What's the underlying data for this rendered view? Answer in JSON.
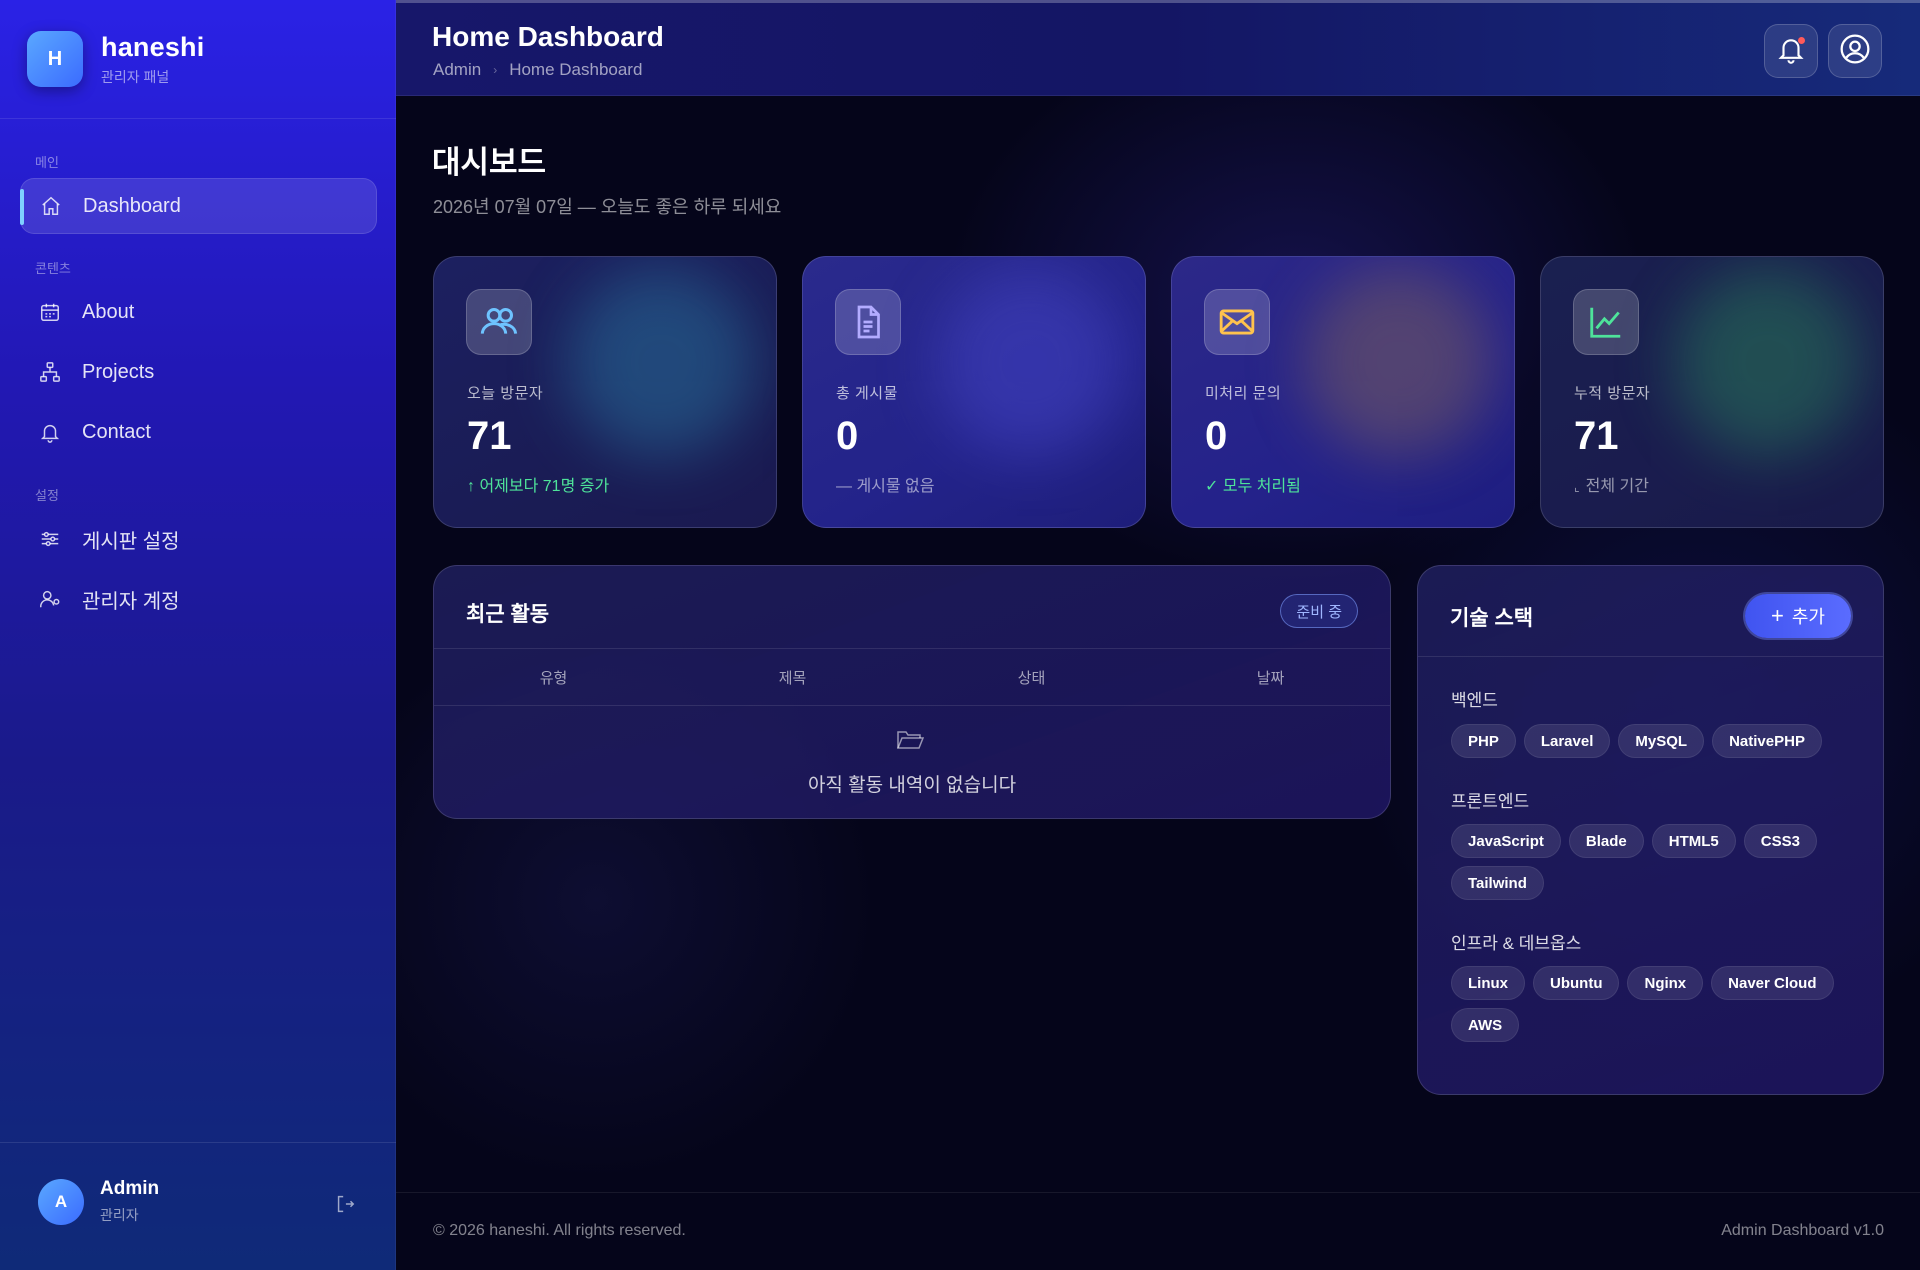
{
  "brand": {
    "logo_letter": "H",
    "name": "haneshi",
    "subtitle": "관리자 패널"
  },
  "sidebar": {
    "sections": [
      {
        "label": "메인"
      },
      {
        "label": "콘텐츠"
      },
      {
        "label": "설정"
      }
    ],
    "items": [
      {
        "label": "Dashboard",
        "icon": "home-icon",
        "active": true
      },
      {
        "label": "About",
        "icon": "calendar-icon"
      },
      {
        "label": "Projects",
        "icon": "sitemap-icon"
      },
      {
        "label": "Contact",
        "icon": "bell-icon"
      },
      {
        "label": "게시판 설정",
        "icon": "sliders-icon"
      },
      {
        "label": "관리자 계정",
        "icon": "user-gear-icon"
      }
    ],
    "user": {
      "avatar_letter": "A",
      "name": "Admin",
      "role": "관리자"
    }
  },
  "header": {
    "title": "Home Dashboard",
    "breadcrumb": [
      "Admin",
      "Home Dashboard"
    ]
  },
  "main": {
    "heading": "대시보드",
    "subtitle": "2026년 07월 07일 — 오늘도 좋은 하루 되세요"
  },
  "stats": [
    {
      "label": "오늘 방문자",
      "value": "71",
      "note": "↑ 어제보다 71명 증가",
      "icon": "users-icon",
      "color": "#6ec3ff"
    },
    {
      "label": "총 게시물",
      "value": "0",
      "note": "— 게시물 없음",
      "icon": "document-icon",
      "color": "#a9a3ff"
    },
    {
      "label": "미처리 문의",
      "value": "0",
      "note": "✓ 모두 처리됨",
      "icon": "mail-icon",
      "color": "#ffc34d"
    },
    {
      "label": "누적 방문자",
      "value": "71",
      "note": "전체 기간",
      "icon": "chart-line-icon",
      "color": "#4ee39a"
    }
  ],
  "activity": {
    "title": "최근 활동",
    "status": "준비 중",
    "columns": [
      "유형",
      "제목",
      "상태",
      "날짜"
    ],
    "empty_text": "아직 활동 내역이 없습니다"
  },
  "tech": {
    "title": "기술 스택",
    "add_label": "추가",
    "groups": [
      {
        "title": "백엔드",
        "items": [
          "PHP",
          "Laravel",
          "MySQL",
          "NativePHP"
        ]
      },
      {
        "title": "프론트엔드",
        "items": [
          "JavaScript",
          "Blade",
          "HTML5",
          "CSS3",
          "Tailwind"
        ]
      },
      {
        "title": "인프라 & 데브옵스",
        "items": [
          "Linux",
          "Ubuntu",
          "Nginx",
          "Naver Cloud",
          "AWS"
        ]
      }
    ]
  },
  "footer": {
    "copyright": "© 2026 haneshi. All rights reserved.",
    "version": "Admin Dashboard v1.0"
  }
}
